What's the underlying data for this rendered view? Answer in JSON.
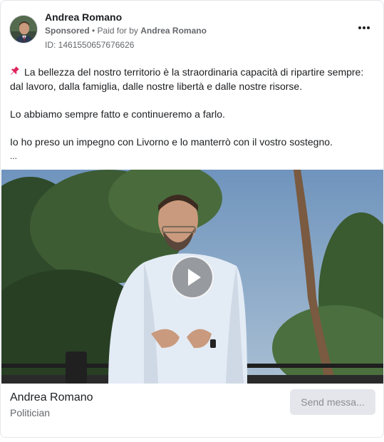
{
  "post": {
    "author": "Andrea Romano",
    "sponsored_label": "Sponsored",
    "paid_for_prefix": " • Paid for by ",
    "paid_for_name": "Andrea Romano",
    "ad_id": "ID: 1461550657676626",
    "more_icon": "more-horizontal-icon",
    "paragraphs": [
      "La bellezza del nostro territorio è la straordinaria capacità di ripartire sempre: dal lavoro, dalla famiglia, dalle nostre libertà e dalle nostre risorse.",
      "Lo abbiamo sempre fatto e continueremo a farlo.",
      "Io ho preso un impegno con Livorno e lo manterrò con il vostro sostegno."
    ],
    "ellipsis": "...",
    "pin_icon": "pushpin-icon"
  },
  "media": {
    "type": "video",
    "play_icon": "play-icon"
  },
  "footer": {
    "advertiser_name": "Andrea Romano",
    "category": "Politician",
    "cta_label": "Send messa..."
  },
  "colors": {
    "text_primary": "#1c1e21",
    "text_secondary": "#65676b",
    "cta_bg": "#e4e6eb",
    "cta_text": "#8a8d91",
    "pin": "#e0245e"
  }
}
